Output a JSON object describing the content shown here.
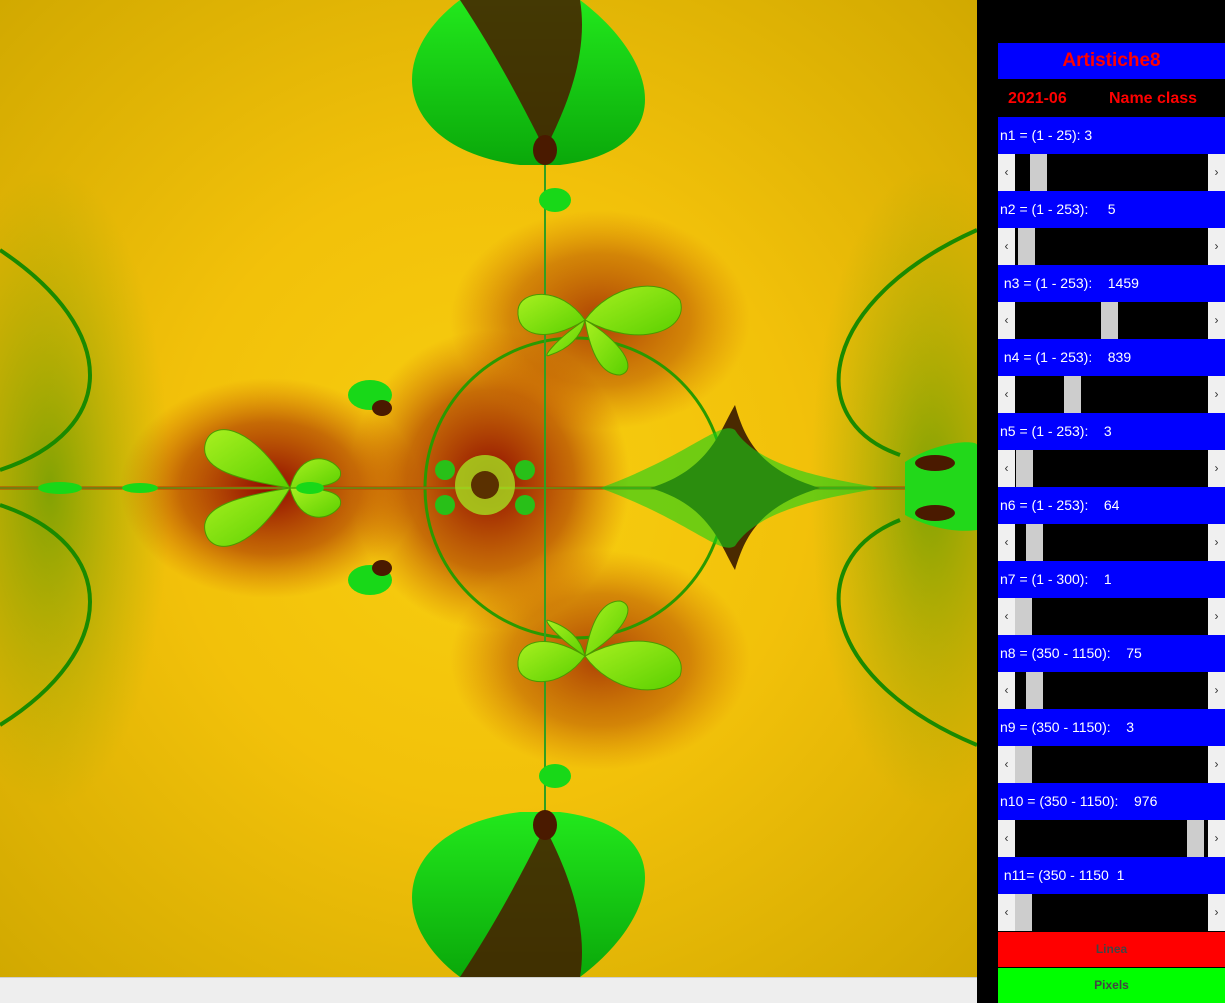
{
  "app": {
    "title": "Artistiche8",
    "date": "2021-06",
    "class_label": "Name class"
  },
  "params": [
    {
      "label": "n1 = (1 - 25): 3",
      "value": 3,
      "min": 1,
      "max": 25
    },
    {
      "label": "n2 = (1 - 253):     5",
      "value": 5,
      "min": 1,
      "max": 253
    },
    {
      "label": " n3 = (1 - 253):    1459",
      "value": 1459,
      "min": 1,
      "max": 3000
    },
    {
      "label": " n4 = (1 - 253):    839",
      "value": 839,
      "min": 1,
      "max": 3000
    },
    {
      "label": "n5 = (1 - 253):    3",
      "value": 3,
      "min": 1,
      "max": 253
    },
    {
      "label": "n6 = (1 - 253):    64",
      "value": 64,
      "min": 1,
      "max": 1000
    },
    {
      "label": "n7 = (1 - 300):    1",
      "value": 1,
      "min": 1,
      "max": 300
    },
    {
      "label": "n8 = (350 - 1150):    75",
      "value": 75,
      "min": 1,
      "max": 1150
    },
    {
      "label": "n9 = (350 - 1150):    3",
      "value": 3,
      "min": 1,
      "max": 1150
    },
    {
      "label": "n10 = (350 - 1150):    976",
      "value": 976,
      "min": 1,
      "max": 1000
    },
    {
      "label": " n11= (350 - 1150  1",
      "value": 1,
      "min": 1,
      "max": 1150
    }
  ],
  "buttons": {
    "linea_label": "Linea",
    "pixels_label": "Pixels"
  },
  "colors": {
    "panel_blue": "#0000ff",
    "title_red": "#ff0000",
    "linea_bg": "#ff0000",
    "pixels_bg": "#00ff00",
    "fractal_yellow": "#f5c800",
    "fractal_green": "#22dd22",
    "fractal_red": "#8b0000"
  }
}
